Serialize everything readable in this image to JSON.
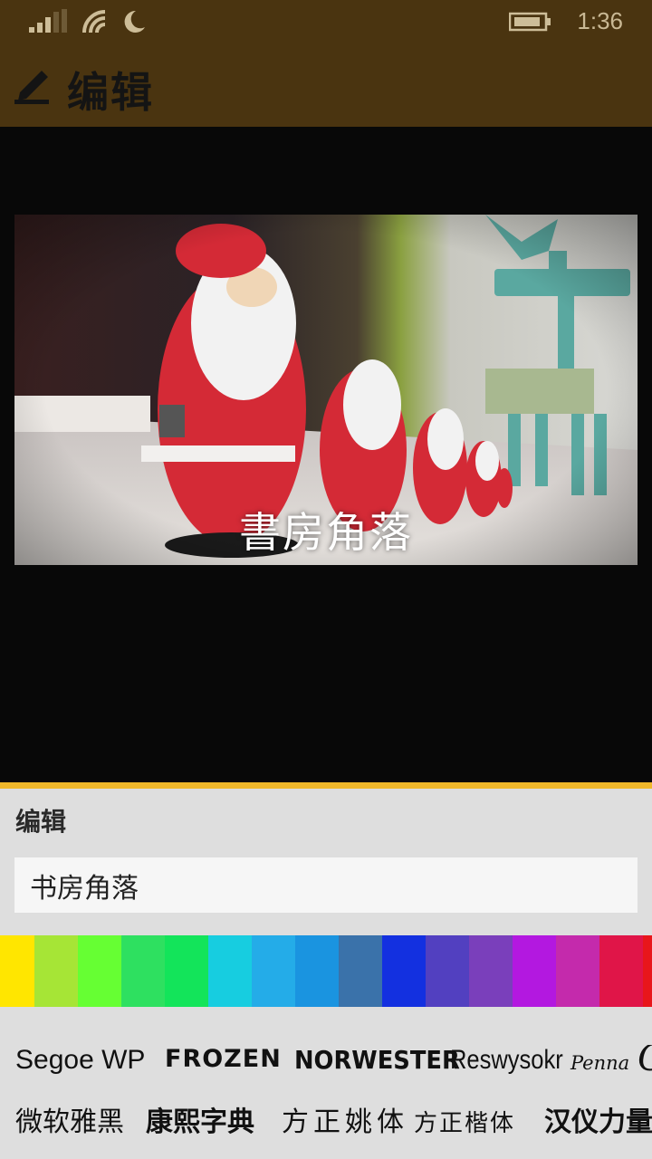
{
  "status_bar": {
    "time": "1:36",
    "icons": [
      "signal-icon",
      "wifi-icon",
      "moon-icon",
      "battery-icon"
    ]
  },
  "header": {
    "title": "编辑",
    "icon": "edit-pen-icon"
  },
  "preview": {
    "overlay_text": "書房角落",
    "image": "matryoshka-santa-dolls-and-wooden-reindeer-photo"
  },
  "panel": {
    "title": "编辑",
    "text_field_value": "书房角落",
    "accent_color": "#f0b82a"
  },
  "palette": [
    "#ffe600",
    "#a6e536",
    "#66ff33",
    "#2ee060",
    "#13e45a",
    "#17cde0",
    "#24ace8",
    "#1a94e0",
    "#3a72aa",
    "#1330e0",
    "#5240c0",
    "#7a3fbb",
    "#b318e0",
    "#c42aac",
    "#e01548",
    "#e8161b"
  ],
  "fonts_latin": [
    "Segoe WP",
    "FROZEN",
    "NORWESTER",
    "Reswysokr",
    "Penna",
    "C"
  ],
  "fonts_cjk": [
    "微软雅黑",
    "康熙字典",
    "方正姚体",
    "方正楷体",
    "汉仪力量"
  ]
}
